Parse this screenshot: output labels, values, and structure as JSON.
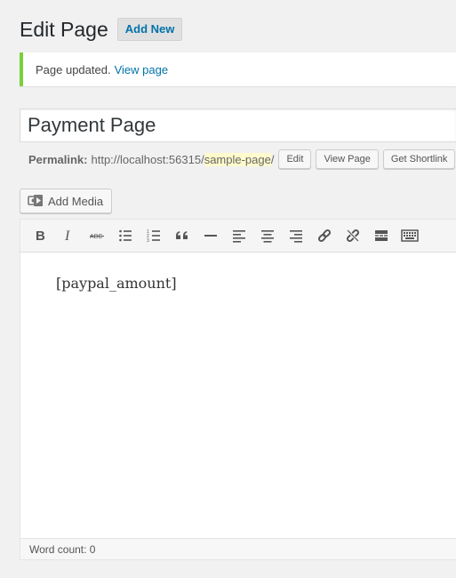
{
  "header": {
    "title": "Edit Page",
    "add_new_label": "Add New"
  },
  "notice": {
    "text": "Page updated.",
    "link_label": "View page",
    "border_color": "#7ad03a"
  },
  "post": {
    "title": "Payment Page"
  },
  "permalink": {
    "label": "Permalink:",
    "base_url": "http://localhost:56315/",
    "slug": "sample-page",
    "trailing": "/",
    "edit_label": "Edit",
    "view_label": "View Page",
    "shortlink_label": "Get Shortlink"
  },
  "media": {
    "add_media_label": "Add Media",
    "icon": "add-media-icon"
  },
  "toolbar": {
    "buttons": [
      "bold-icon",
      "italic-icon",
      "strikethrough-icon",
      "bullet-list-icon",
      "numbered-list-icon",
      "blockquote-icon",
      "horizontal-rule-icon",
      "align-left-icon",
      "align-center-icon",
      "align-right-icon",
      "insert-link-icon",
      "remove-link-icon",
      "read-more-icon",
      "toolbar-toggle-icon"
    ]
  },
  "editor": {
    "content": "[paypal_amount]",
    "word_count": "Word count: 0"
  }
}
